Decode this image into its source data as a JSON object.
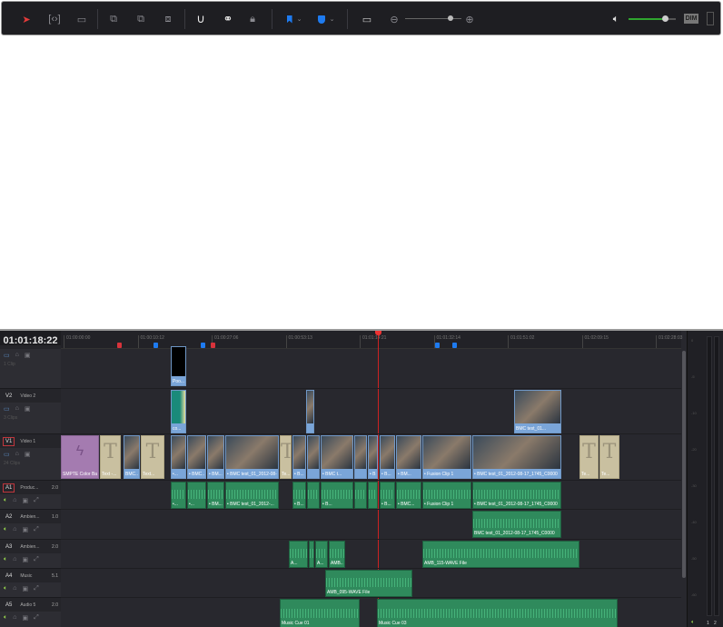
{
  "toolbar": {
    "tools": [
      {
        "name": "selection-mode-icon",
        "color": "#e23b3b"
      },
      {
        "name": "trim-edit-mode-icon"
      },
      {
        "name": "dynamic-trim-mode-icon"
      },
      {
        "name": "overwrite-clip-icon"
      },
      {
        "name": "replace-clip-icon"
      },
      {
        "name": "place-on-top-icon"
      },
      {
        "name": "snapping-icon"
      },
      {
        "name": "linked-selection-icon"
      },
      {
        "name": "position-lock-icon"
      },
      {
        "name": "flag-icon",
        "color": "#1e7bf0"
      },
      {
        "name": "marker-icon",
        "color": "#1e7bf0"
      },
      {
        "name": "zoom-mode-icon"
      }
    ],
    "zoom_level": 0.8,
    "volume_level": 0.76,
    "dim_label": "DIM"
  },
  "timeline": {
    "timecode": "01:01:18:22",
    "ruler": [
      "01:00:00:00",
      "01:00:10:12",
      "01:00:27:06",
      "01:00:53:13",
      "01:01:14:21",
      "01:01:32:14",
      "01:01:51:02",
      "01:02:09:15",
      "01:02:28:03"
    ],
    "markers": [
      {
        "color": "#d8333b"
      },
      {
        "color": "#1e7bf0"
      },
      {
        "color": "#1e7bf0"
      },
      {
        "color": "#d8333b"
      },
      {
        "color": "#1e7bf0"
      },
      {
        "color": "#1e7bf0"
      }
    ],
    "tracks": [
      {
        "id": "",
        "name": "",
        "count": "1 Clip"
      },
      {
        "id": "V2",
        "name": "Video 2",
        "count": "3 Clips"
      },
      {
        "id": "V1",
        "name": "Video 1",
        "count": "24 Clips"
      },
      {
        "id": "A1",
        "name": "Produc...",
        "channels": "2.0"
      },
      {
        "id": "A2",
        "name": "Ambien...",
        "channels": "1.0"
      },
      {
        "id": "A3",
        "name": "Ambien...",
        "channels": "2.0"
      },
      {
        "id": "A4",
        "name": "Music",
        "channels": "5.1"
      },
      {
        "id": "A5",
        "name": "Audio 5",
        "channels": "2.0"
      }
    ],
    "clips": [
      "Poo...",
      "co...",
      "",
      "BMC test_01...",
      "SMPTE Color Bar",
      "Text -...",
      "BMC...",
      "Text...",
      "•...",
      "• BMC...",
      "• BM...",
      "• BMC test_01_2012-08-...",
      "Te...",
      "• B...",
      "",
      "• BMC t...",
      "",
      "• B...",
      "• B...",
      "• BM...",
      "• Fusion Clip 1",
      "• BMC test_01_2012-08-17_1745_C0000",
      "Te...",
      "Te...",
      "•...",
      "•...",
      "• BM...",
      "• BMC test_01_2012-...",
      "• B...",
      "",
      "• B...",
      "",
      "",
      "• B...",
      "• BMC...",
      "• Fusion Clip 1",
      "• BMC test_01_2012-08-17_1745_C0000",
      "BMC test_01_2012-08-17_1745_C0000",
      "A...",
      "",
      "A...",
      "AMB...",
      "AMB_115-WAVE File",
      "AMB_095-WAVE File",
      "Music Cue 01",
      "Music Cue 03"
    ],
    "meter_scale": [
      "0",
      "-5",
      "-10",
      "-20",
      "-30",
      "-40",
      "-50",
      "-60"
    ],
    "meter_channels": [
      "1",
      "2"
    ]
  }
}
